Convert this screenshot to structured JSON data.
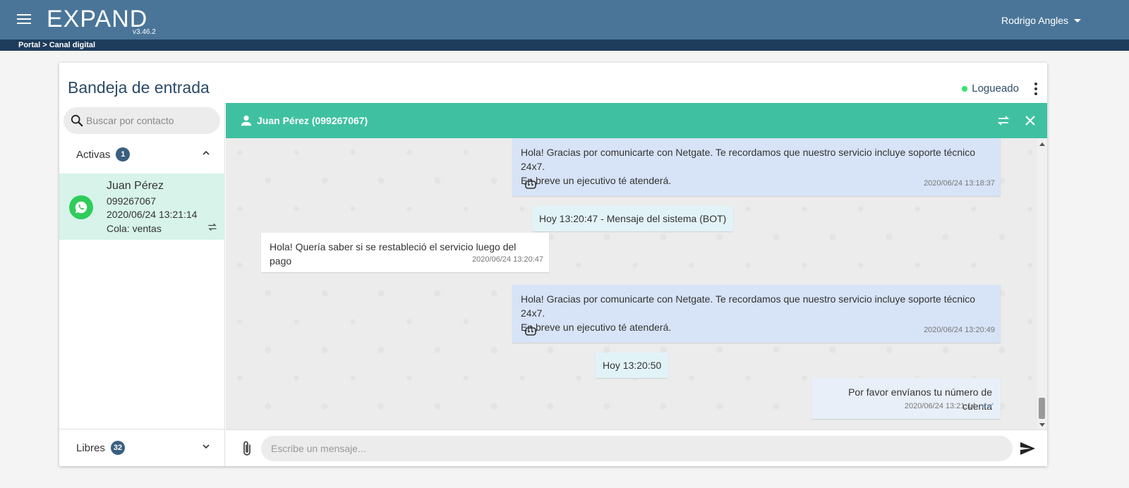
{
  "topbar": {
    "logo": "EXPAND",
    "version": "v3.46.2",
    "user": "Rodrigo Angles"
  },
  "breadcrumb": "Portal > Canal digital",
  "inbox": {
    "title": "Bandeja de entrada",
    "status": "Logueado",
    "status_color": "#2ee66b"
  },
  "sidebar": {
    "search_placeholder": "Buscar por contacto",
    "active": {
      "label": "Activas",
      "count": "1"
    },
    "free": {
      "label": "Libres",
      "count": "32"
    },
    "contact": {
      "name": "Juan Pérez",
      "phone": "099267067",
      "date": "2020/06/24 13:21:14",
      "queue": "Cola: ventas"
    }
  },
  "chat": {
    "header_title": "Juan Pérez (099267067)",
    "header_color": "#3fc1a1",
    "messages": [
      {
        "type": "bot",
        "line1": "Hola! Gracias por comunicarte con Netgate. Te recordamos que nuestro servicio incluye soporte técnico 24x7.",
        "line2": "En breve un ejecutivo té atenderá.",
        "time": "2020/06/24 13:18:37"
      },
      {
        "type": "system",
        "text": "Hoy 13:20:47 - Mensaje del sistema (BOT)"
      },
      {
        "type": "incoming",
        "line1": "Hola! Quería saber si se restableció el servicio luego del pago",
        "time": "2020/06/24 13:20:47"
      },
      {
        "type": "bot",
        "line1": "Hola! Gracias por comunicarte con Netgate. Te recordamos que nuestro servicio incluye soporte técnico 24x7.",
        "line2": "En breve un ejecutivo té atenderá.",
        "time": "2020/06/24 13:20:49"
      },
      {
        "type": "system",
        "text": "Hoy 13:20:50"
      },
      {
        "type": "outgoing",
        "line1": "Por favor envíanos tu número de cuenta",
        "time": "2020/06/24 13:21:14"
      }
    ],
    "composer_placeholder": "Escribe un mensaje..."
  }
}
